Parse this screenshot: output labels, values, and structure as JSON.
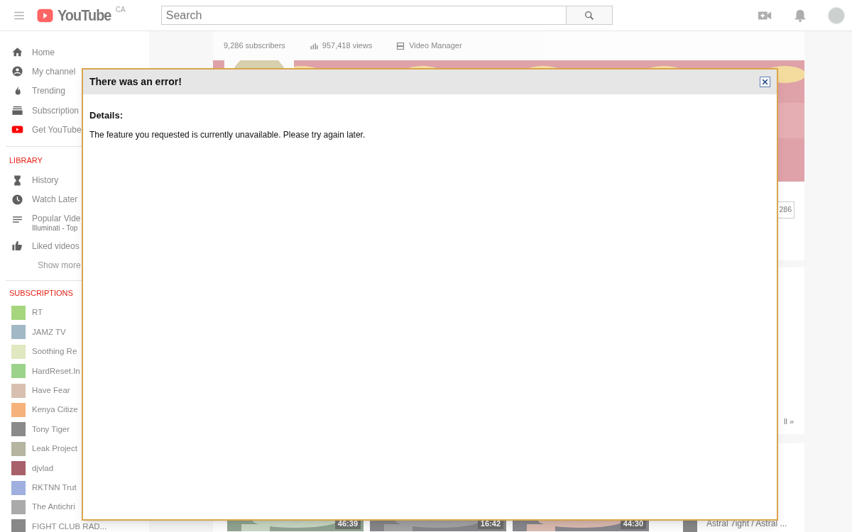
{
  "header": {
    "logo_text": "YouTube",
    "region": "CA",
    "search": {
      "placeholder": "Search"
    }
  },
  "sidebar": {
    "main_items": [
      {
        "kind": "home",
        "label": "Home"
      },
      {
        "kind": "person",
        "label": "My channel"
      },
      {
        "kind": "flame",
        "label": "Trending"
      },
      {
        "kind": "stack",
        "label": "Subscription"
      },
      {
        "kind": "play",
        "label": "Get YouTube"
      }
    ],
    "library": {
      "heading": "LIBRARY",
      "items": [
        {
          "kind": "hourglass",
          "label": "History"
        },
        {
          "kind": "clock",
          "label": "Watch Later"
        },
        {
          "kind": "list",
          "label": "Popular Vide",
          "sublabel": "Illuminati - Top"
        },
        {
          "kind": "thumb",
          "label": "Liked videos"
        }
      ],
      "show_more": "Show more"
    },
    "subscriptions": {
      "heading": "SUBSCRIPTIONS",
      "items": [
        {
          "label": "RT",
          "color": "#a5d67e"
        },
        {
          "label": "JAMZ TV",
          "color": "#a3b8c6"
        },
        {
          "label": "Soothing Re",
          "color": "#dfe8c0"
        },
        {
          "label": "HardReset.In",
          "color": "#9cd38a"
        },
        {
          "label": "Have Fear",
          "color": "#d8c0b0"
        },
        {
          "label": "Kenya Citize",
          "color": "#f5b27a"
        },
        {
          "label": "Tony Tiger",
          "color": "#8a8a8a"
        },
        {
          "label": "Leak Project",
          "color": "#b5b5a0"
        },
        {
          "label": "djvlad",
          "color": "#a8606a"
        },
        {
          "label": "RKTNN Trut",
          "color": "#9fb0e0"
        },
        {
          "label": "The Antichri",
          "color": "#aaaaaa"
        },
        {
          "label": "FIGHT CLUB RAD...",
          "color": "#888888"
        }
      ]
    }
  },
  "channel": {
    "stats": [
      {
        "kind": "text",
        "text": "9,286 subscribers"
      },
      {
        "kind": "chart",
        "text": "957,418 views"
      },
      {
        "kind": "manager",
        "text": "Video Manager"
      }
    ],
    "subscriber_count": "286",
    "see_all": "ll »",
    "videos": [
      {
        "duration": "46:39"
      },
      {
        "duration": "16:42"
      },
      {
        "duration": "44:30"
      }
    ],
    "related": [
      {
        "title": "Astral 7ight / Astral ..."
      }
    ]
  },
  "dialog": {
    "title": "There was an error!",
    "details_label": "Details:",
    "message": "The feature you requested is currently unavailable. Please try again later."
  }
}
